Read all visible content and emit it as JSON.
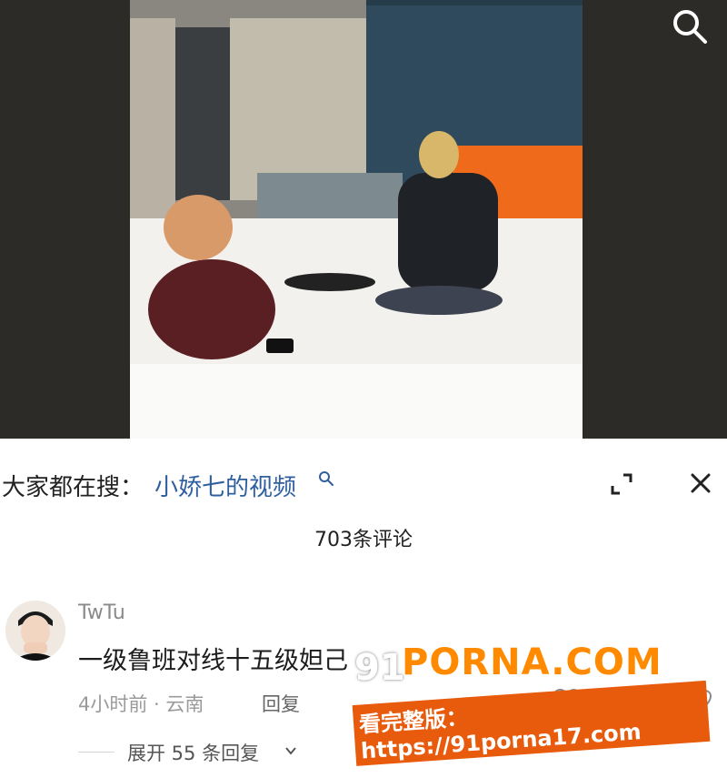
{
  "video": {
    "search_icon": "search-icon"
  },
  "search_suggest": {
    "prefix": "大家都在搜：",
    "keyword": "小娇七的视频",
    "keyword_icon": "search-icon",
    "expand_icon": "expand-icon",
    "close_icon": "close-icon"
  },
  "comments": {
    "count_label": "703条评论",
    "items": [
      {
        "username": "TwTu",
        "text": "一级鲁班对线十五级妲己",
        "time_location": "4小时前 · 云南",
        "reply_label": "回复",
        "like_count": "233",
        "expand_label": "展开 55 条回复"
      }
    ]
  },
  "watermark": {
    "prefix": "91",
    "brand": "PORNA.COM",
    "line2": "看完整版：https://91porna17.com"
  },
  "colors": {
    "keyword": "#2f5f9e",
    "watermark_orange": "#ff8a00",
    "video_bg": "#2c2b28"
  }
}
